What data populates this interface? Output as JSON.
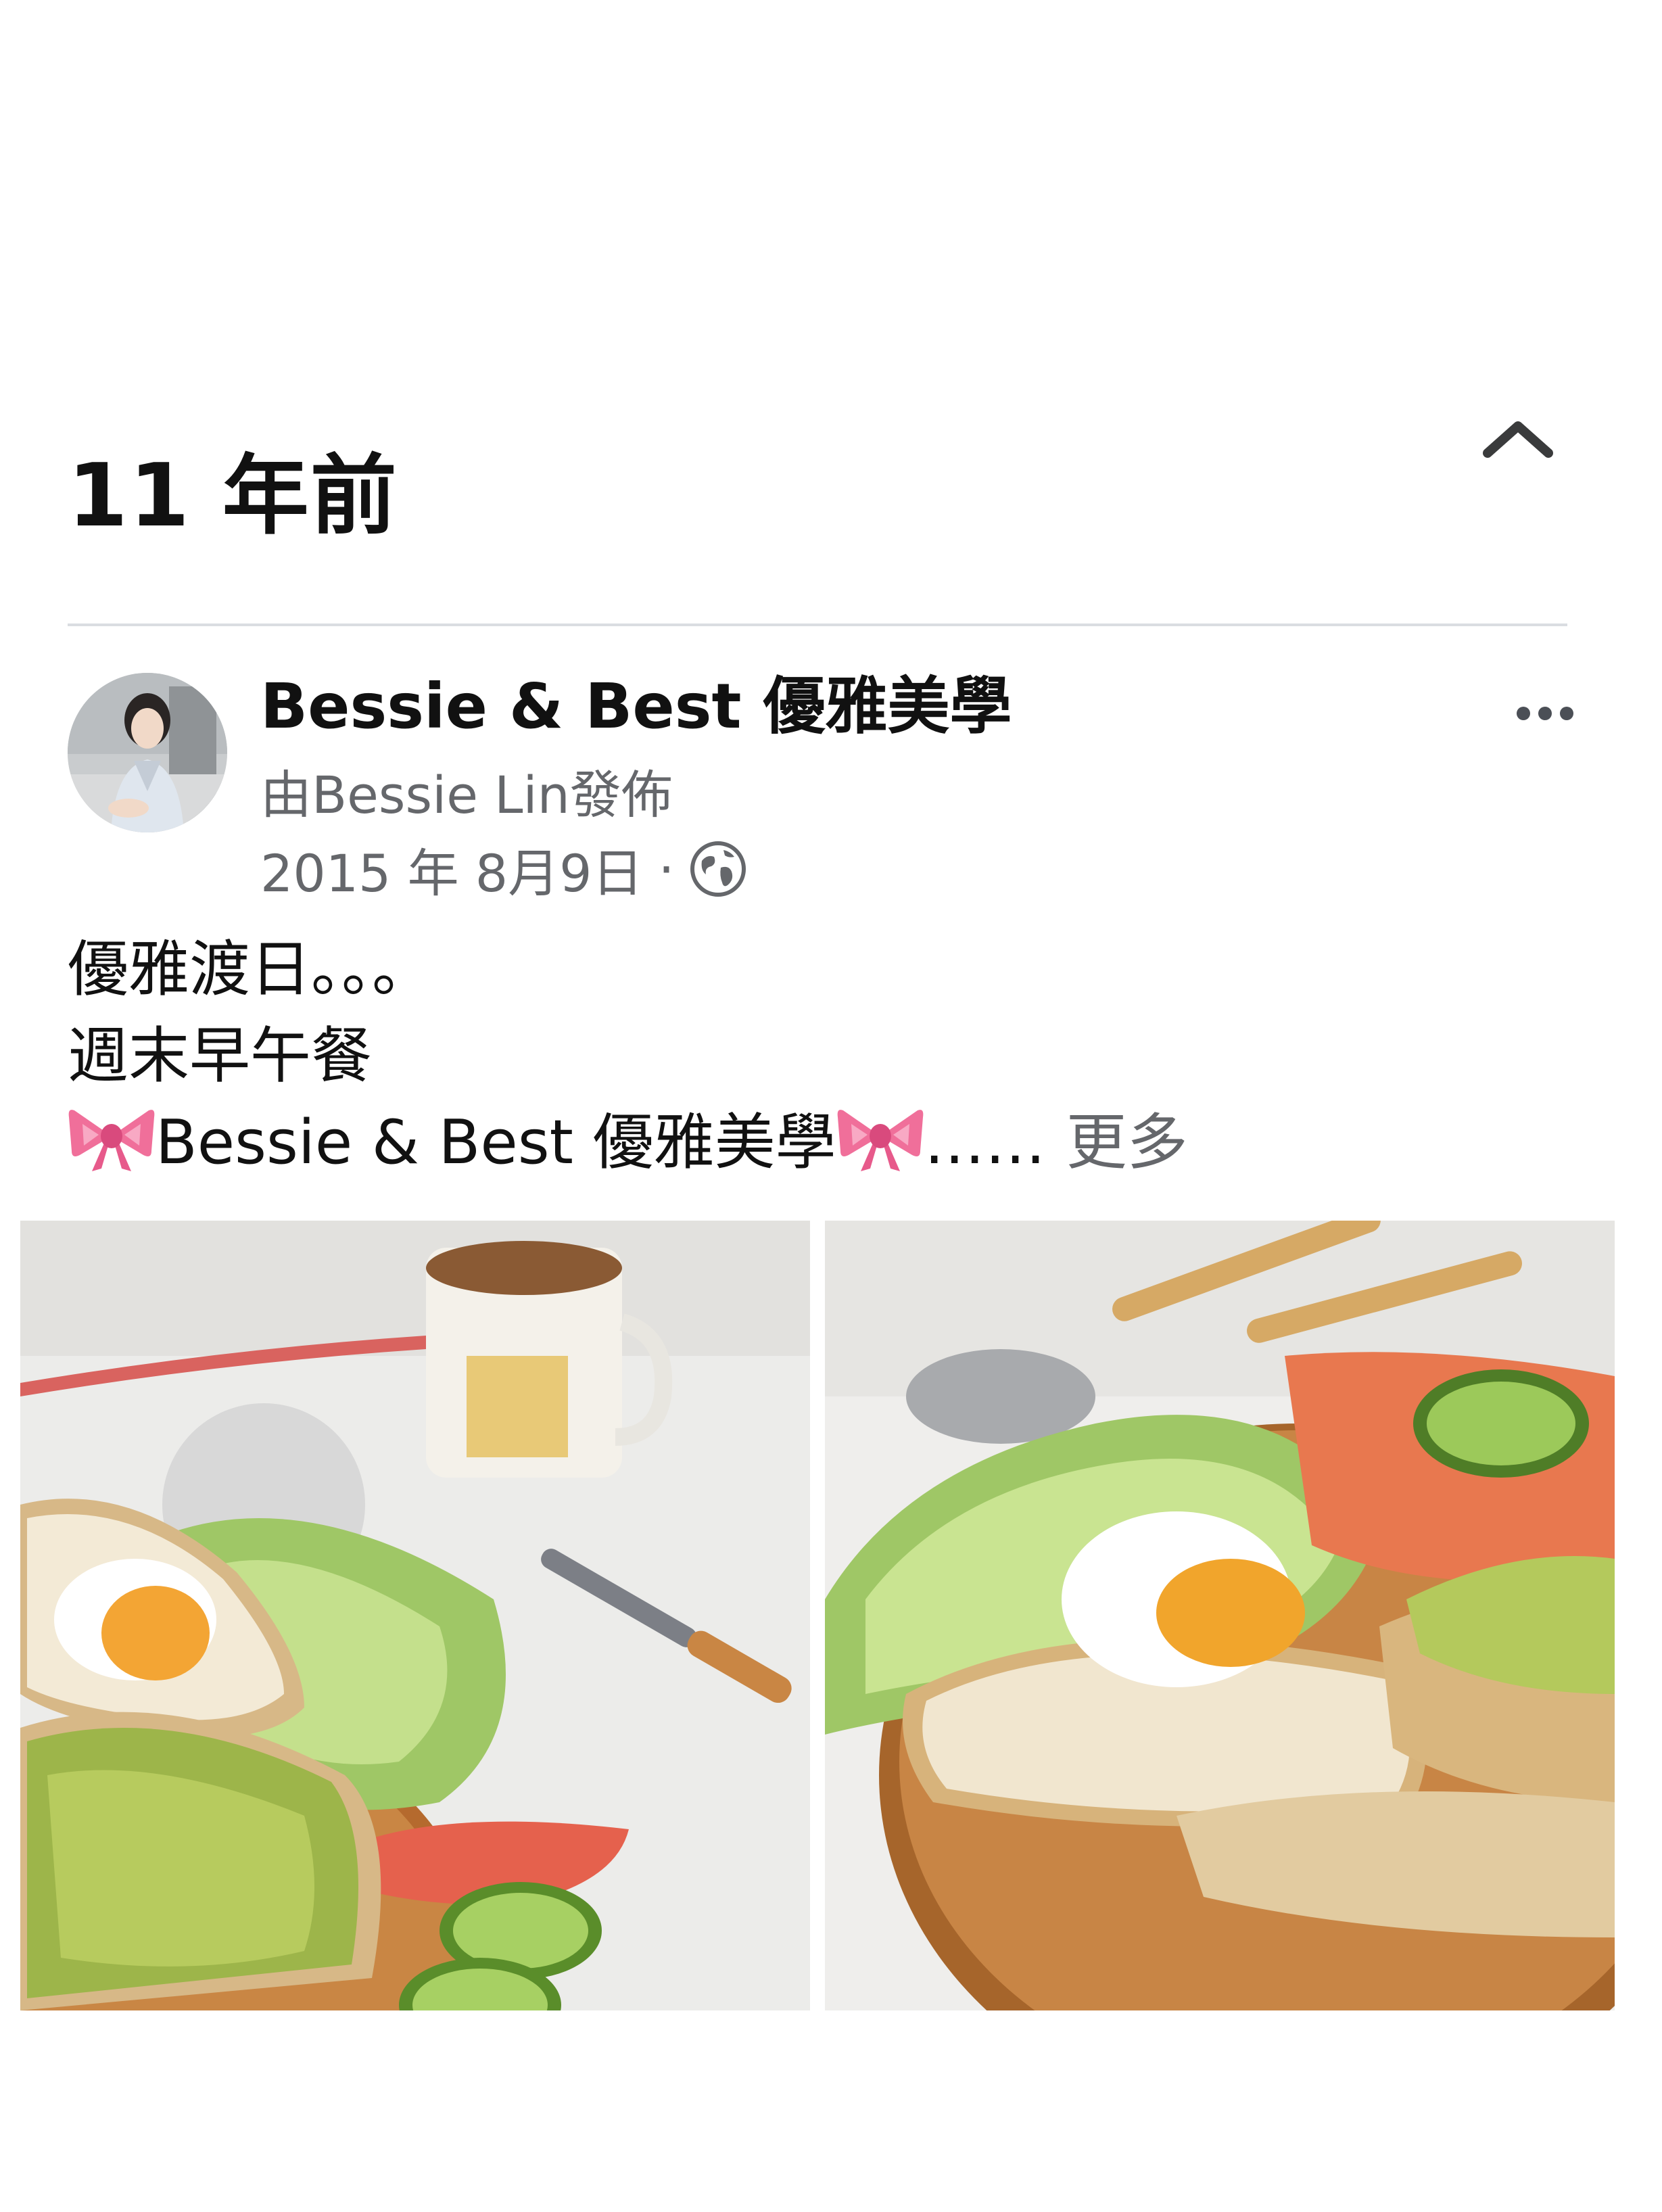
{
  "memory": {
    "heading": "11 年前"
  },
  "post": {
    "page_name": "Bessie & Best 優雅美學",
    "posted_by": "由Bessie Lin發佈",
    "date": "2015 年 8月9日",
    "separator": "·",
    "privacy_icon": "globe-icon",
    "more_options_icon": "more-horizontal-icon",
    "text_lines": [
      "優雅渡日。。。",
      "週末早午餐"
    ],
    "line3_text": "Bessie & Best 優雅美學",
    "line3_ellipsis": "……",
    "see_more": "更多",
    "emoji_icon": "ribbon-bow-icon",
    "photos": [
      {
        "icon": "brunch-photo-1"
      },
      {
        "icon": "brunch-photo-2"
      }
    ]
  },
  "colors": {
    "text_primary": "#111111",
    "text_secondary": "#65676b",
    "divider": "#dadde1",
    "bow_pink": "#f06f9a"
  }
}
